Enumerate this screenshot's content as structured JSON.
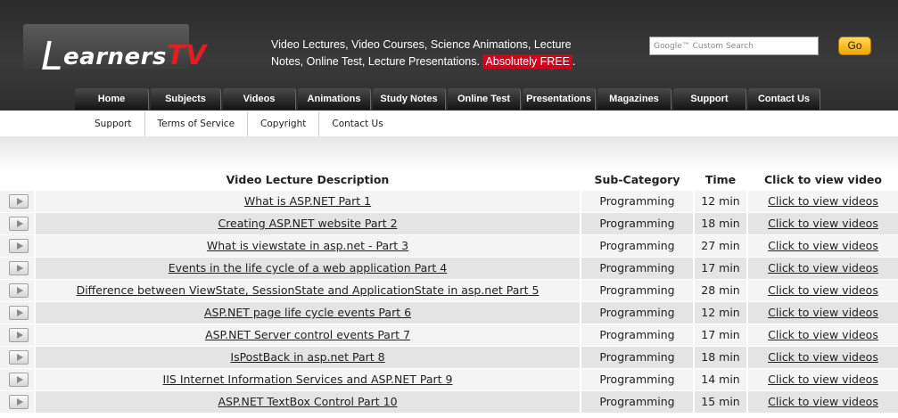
{
  "brand": {
    "logo_l": "L",
    "logo_word": "earners",
    "logo_tv": "TV"
  },
  "header": {
    "tagline": "Video Lectures, Video Courses, Science Animations, Lecture Notes, Online Test, Lecture Presentations.",
    "free_badge": "Absolutely FREE",
    "free_suffix": ".",
    "search_placeholder": "Google™ Custom Search",
    "go_label": "Go"
  },
  "nav": [
    {
      "label": "Home"
    },
    {
      "label": "Subjects"
    },
    {
      "label": "Videos"
    },
    {
      "label": "Animations"
    },
    {
      "label": "Study Notes"
    },
    {
      "label": "Online Test"
    },
    {
      "label": "Presentations"
    },
    {
      "label": "Magazines"
    },
    {
      "label": "Support"
    },
    {
      "label": "Contact Us"
    }
  ],
  "subnav": [
    {
      "label": "Support"
    },
    {
      "label": "Terms of Service"
    },
    {
      "label": "Copyright"
    },
    {
      "label": "Contact Us"
    }
  ],
  "table": {
    "headers": {
      "description": "Video Lecture Description",
      "category": "Sub-Category",
      "time": "Time",
      "link": "Click to view video"
    },
    "rows": [
      {
        "title": "What is ASP.NET Part 1",
        "category": "Programming",
        "time": "12 min",
        "link": "Click to view videos"
      },
      {
        "title": "Creating ASP.NET website Part 2",
        "category": "Programming",
        "time": "18 min",
        "link": "Click to view videos"
      },
      {
        "title": "What is viewstate in asp.net - Part 3",
        "category": "Programming",
        "time": "27 min",
        "link": "Click to view videos"
      },
      {
        "title": "Events in the life cycle of a web application Part 4",
        "category": "Programming",
        "time": "17 min",
        "link": "Click to view videos"
      },
      {
        "title": "Difference between ViewState, SessionState and ApplicationState in asp.net Part 5",
        "category": "Programming",
        "time": "28 min",
        "link": "Click to view videos"
      },
      {
        "title": "ASP.NET page life cycle events Part 6",
        "category": "Programming",
        "time": "12 min",
        "link": "Click to view videos"
      },
      {
        "title": "ASP.NET Server control events Part 7",
        "category": "Programming",
        "time": "17 min",
        "link": "Click to view videos"
      },
      {
        "title": "IsPostBack in asp.net Part 8",
        "category": "Programming",
        "time": "18 min",
        "link": "Click to view videos"
      },
      {
        "title": "IIS Internet Information Services and ASP.NET Part 9",
        "category": "Programming",
        "time": "14 min",
        "link": "Click to view videos"
      },
      {
        "title": "ASP.NET TextBox Control Part 10",
        "category": "Programming",
        "time": "15 min",
        "link": "Click to view videos"
      }
    ]
  }
}
